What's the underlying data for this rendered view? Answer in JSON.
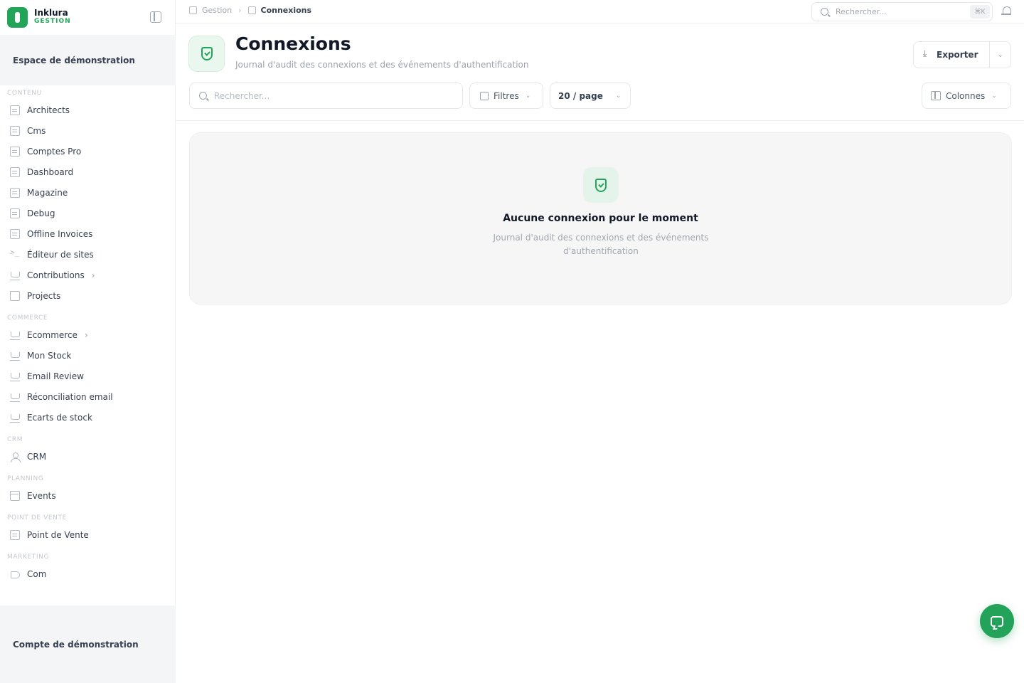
{
  "app": {
    "name": "Inklura",
    "subtitle": "GESTION"
  },
  "workspace": {
    "label": "Espace de démonstration"
  },
  "sidebar": {
    "sections": [
      {
        "title": "CONTENU",
        "items": [
          {
            "label": "Architects",
            "icon": "building-icon"
          },
          {
            "label": "Cms",
            "icon": "document-icon"
          },
          {
            "label": "Comptes Pro",
            "icon": "document-icon"
          },
          {
            "label": "Dashboard",
            "icon": "layout-icon"
          },
          {
            "label": "Magazine",
            "icon": "book-icon"
          },
          {
            "label": "Debug",
            "icon": "document-icon"
          },
          {
            "label": "Offline Invoices",
            "icon": "document-icon"
          },
          {
            "label": "Éditeur de sites",
            "icon": "terminal-icon"
          },
          {
            "label": "Contributions",
            "icon": "database-icon",
            "chevron": "›"
          },
          {
            "label": "Projects",
            "icon": "folder-icon"
          }
        ]
      },
      {
        "title": "COMMERCE",
        "items": [
          {
            "label": "Ecommerce",
            "icon": "cart-icon",
            "chevron": "›"
          },
          {
            "label": "Mon Stock",
            "icon": "cart-icon"
          },
          {
            "label": "Email Review",
            "icon": "cart-icon"
          },
          {
            "label": "Réconciliation email",
            "icon": "cart-icon"
          },
          {
            "label": "Ecarts de stock",
            "icon": "cart-icon"
          }
        ]
      },
      {
        "title": "CRM",
        "items": [
          {
            "label": "CRM",
            "icon": "user-icon"
          }
        ]
      },
      {
        "title": "PLANNING",
        "items": [
          {
            "label": "Events",
            "icon": "calendar-icon"
          }
        ]
      },
      {
        "title": "POINT DE VENTE",
        "items": [
          {
            "label": "Point de Vente",
            "icon": "store-icon"
          }
        ]
      },
      {
        "title": "MARKETING",
        "items": [
          {
            "label": "Com",
            "icon": "megaphone-icon"
          }
        ]
      }
    ]
  },
  "account": {
    "label": "Compte de démonstration"
  },
  "topbar": {
    "breadcrumb_root": "Gestion",
    "breadcrumb_separator": "›",
    "breadcrumb_current": "Connexions",
    "search_placeholder": "Rechercher...",
    "search_shortcut": "⌘K"
  },
  "header": {
    "title": "Connexions",
    "subtitle": "Journal d'audit des connexions et des événements d'authentification",
    "export_label": "Exporter",
    "search_placeholder": "Rechercher...",
    "filters_label": "Filtres",
    "per_page_label": "20 / page",
    "columns_label": "Colonnes"
  },
  "empty_state": {
    "title": "Aucune connexion pour le moment",
    "text": "Journal d'audit des connexions et des événements d'authentification"
  },
  "colors": {
    "brand": "#22a559",
    "sidebar_band": "#f4f5f7",
    "empty_bg": "#f6f6f7"
  }
}
